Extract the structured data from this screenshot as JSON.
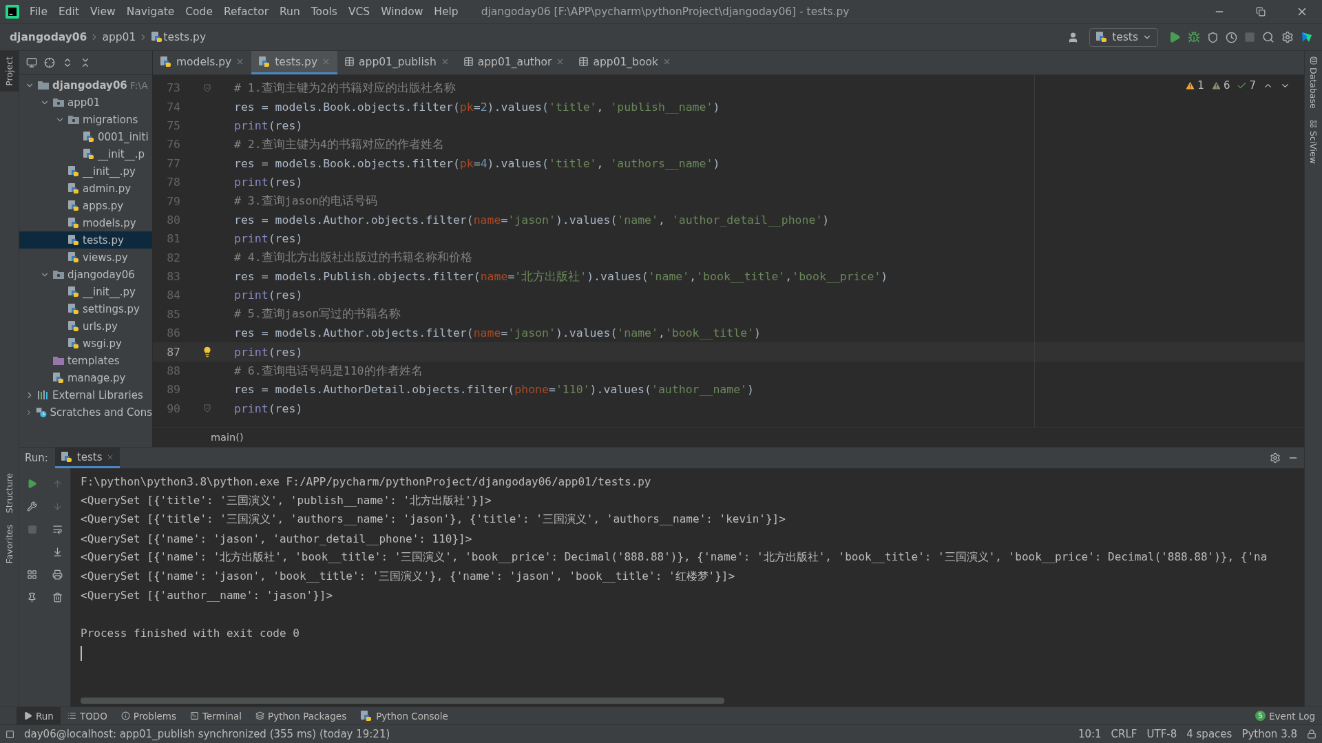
{
  "menu_bar": {
    "items": [
      "File",
      "Edit",
      "View",
      "Navigate",
      "Code",
      "Refactor",
      "Run",
      "Tools",
      "VCS",
      "Window",
      "Help"
    ],
    "title": "djangoday06 [F:\\APP\\pycharm\\pythonProject\\djangoday06] - tests.py"
  },
  "breadcrumbs": [
    {
      "label": "djangoday06",
      "kind": "project"
    },
    {
      "label": "app01",
      "kind": "folder"
    },
    {
      "label": "tests.py",
      "kind": "python"
    }
  ],
  "run_config": {
    "label": "tests"
  },
  "left_strip": [
    {
      "label": "Project",
      "selected": true
    },
    {
      "label": "Structure",
      "selected": false
    },
    {
      "label": "Favorites",
      "selected": false
    }
  ],
  "right_strip": [
    "Database",
    "SciView"
  ],
  "editor_tabs": [
    {
      "label": "models.py",
      "kind": "python",
      "selected": false
    },
    {
      "label": "tests.py",
      "kind": "python",
      "selected": true
    },
    {
      "label": "app01_publish",
      "kind": "table",
      "selected": false
    },
    {
      "label": "app01_author",
      "kind": "table",
      "selected": false
    },
    {
      "label": "app01_book",
      "kind": "table",
      "selected": false
    }
  ],
  "project_tree": [
    {
      "label": "djangoday06",
      "hint": "F:\\A",
      "kind": "project",
      "expanded": true,
      "selected": false,
      "children": [
        {
          "label": "app01",
          "kind": "module",
          "expanded": true,
          "selected": false,
          "children": [
            {
              "label": "migrations",
              "kind": "module",
              "expanded": true,
              "selected": false,
              "children": [
                {
                  "label": "0001_initi",
                  "kind": "python",
                  "selected": false
                },
                {
                  "label": "__init__.p",
                  "kind": "python",
                  "selected": false
                }
              ]
            },
            {
              "label": "__init__.py",
              "kind": "python",
              "selected": false
            },
            {
              "label": "admin.py",
              "kind": "python",
              "selected": false
            },
            {
              "label": "apps.py",
              "kind": "python",
              "selected": false
            },
            {
              "label": "models.py",
              "kind": "python",
              "selected": false
            },
            {
              "label": "tests.py",
              "kind": "python",
              "selected": true
            },
            {
              "label": "views.py",
              "kind": "python",
              "selected": false
            }
          ]
        },
        {
          "label": "djangoday06",
          "kind": "module",
          "expanded": true,
          "selected": false,
          "children": [
            {
              "label": "__init__.py",
              "kind": "python",
              "selected": false
            },
            {
              "label": "settings.py",
              "kind": "python",
              "selected": false
            },
            {
              "label": "urls.py",
              "kind": "python",
              "selected": false
            },
            {
              "label": "wsgi.py",
              "kind": "python",
              "selected": false
            }
          ]
        },
        {
          "label": "templates",
          "kind": "templates",
          "selected": false
        },
        {
          "label": "manage.py",
          "kind": "python",
          "selected": false
        }
      ]
    },
    {
      "label": "External Libraries",
      "kind": "libraries",
      "expanded": false,
      "selected": false
    },
    {
      "label": "Scratches and Cons",
      "kind": "scratches",
      "expanded": false,
      "selected": false
    }
  ],
  "inspections": [
    {
      "kind": "warning",
      "count": "1"
    },
    {
      "kind": "weak_warning",
      "count": "6"
    },
    {
      "kind": "typo",
      "count": "7"
    }
  ],
  "code_lines": [
    {
      "number": "73",
      "current": false,
      "fold_marker": true,
      "tokens": [
        {
          "kind": "comment",
          "text": "# 1.查询主键为2的书籍对应的出版社名称"
        }
      ]
    },
    {
      "number": "74",
      "current": false,
      "fold_marker": false,
      "tokens": [
        {
          "kind": "plain",
          "text": "res = models.Book.objects.filter("
        },
        {
          "kind": "param",
          "text": "pk"
        },
        {
          "kind": "plain",
          "text": "="
        },
        {
          "kind": "number",
          "text": "2"
        },
        {
          "kind": "plain",
          "text": ").values("
        },
        {
          "kind": "string",
          "text": "'title'"
        },
        {
          "kind": "plain",
          "text": ", "
        },
        {
          "kind": "string",
          "text": "'publish__name'"
        },
        {
          "kind": "plain",
          "text": ")"
        }
      ]
    },
    {
      "number": "75",
      "current": false,
      "fold_marker": false,
      "tokens": [
        {
          "kind": "builtin",
          "text": "print"
        },
        {
          "kind": "plain",
          "text": "(res)"
        }
      ]
    },
    {
      "number": "76",
      "current": false,
      "fold_marker": false,
      "tokens": [
        {
          "kind": "comment",
          "text": "# 2.查询主键为4的书籍对应的作者姓名"
        }
      ]
    },
    {
      "number": "77",
      "current": false,
      "fold_marker": false,
      "tokens": [
        {
          "kind": "plain",
          "text": "res = models.Book.objects.filter("
        },
        {
          "kind": "param",
          "text": "pk"
        },
        {
          "kind": "plain",
          "text": "="
        },
        {
          "kind": "number",
          "text": "4"
        },
        {
          "kind": "plain",
          "text": ").values("
        },
        {
          "kind": "string",
          "text": "'title'"
        },
        {
          "kind": "plain",
          "text": ", "
        },
        {
          "kind": "string",
          "text": "'authors__name'"
        },
        {
          "kind": "plain",
          "text": ")"
        }
      ]
    },
    {
      "number": "78",
      "current": false,
      "fold_marker": false,
      "tokens": [
        {
          "kind": "builtin",
          "text": "print"
        },
        {
          "kind": "plain",
          "text": "(res)"
        }
      ]
    },
    {
      "number": "79",
      "current": false,
      "fold_marker": false,
      "tokens": [
        {
          "kind": "comment",
          "text": "# 3.查询jason的电话号码"
        }
      ]
    },
    {
      "number": "80",
      "current": false,
      "fold_marker": false,
      "tokens": [
        {
          "kind": "plain",
          "text": "res = models.Author.objects.filter("
        },
        {
          "kind": "param",
          "text": "name"
        },
        {
          "kind": "plain",
          "text": "="
        },
        {
          "kind": "string",
          "text": "'jason'"
        },
        {
          "kind": "plain",
          "text": ").values("
        },
        {
          "kind": "string",
          "text": "'name'"
        },
        {
          "kind": "plain",
          "text": ", "
        },
        {
          "kind": "string",
          "text": "'author_detail__phone'"
        },
        {
          "kind": "plain",
          "text": ")"
        }
      ]
    },
    {
      "number": "81",
      "current": false,
      "fold_marker": false,
      "tokens": [
        {
          "kind": "builtin",
          "text": "print"
        },
        {
          "kind": "plain",
          "text": "(res)"
        }
      ]
    },
    {
      "number": "82",
      "current": false,
      "fold_marker": false,
      "tokens": [
        {
          "kind": "comment",
          "text": "# 4.查询北方出版社出版过的书籍名称和价格"
        }
      ]
    },
    {
      "number": "83",
      "current": false,
      "fold_marker": false,
      "tokens": [
        {
          "kind": "plain",
          "text": "res = models.Publish.objects.filter("
        },
        {
          "kind": "param",
          "text": "name"
        },
        {
          "kind": "plain",
          "text": "="
        },
        {
          "kind": "string",
          "text": "'北方出版社'"
        },
        {
          "kind": "plain",
          "text": ").values("
        },
        {
          "kind": "string",
          "text": "'name'"
        },
        {
          "kind": "plain",
          "text": ","
        },
        {
          "kind": "string",
          "text": "'book__title'"
        },
        {
          "kind": "plain",
          "text": ","
        },
        {
          "kind": "string",
          "text": "'book__price'"
        },
        {
          "kind": "plain",
          "text": ")"
        }
      ]
    },
    {
      "number": "84",
      "current": false,
      "fold_marker": false,
      "tokens": [
        {
          "kind": "builtin",
          "text": "print"
        },
        {
          "kind": "plain",
          "text": "(res)"
        }
      ]
    },
    {
      "number": "85",
      "current": false,
      "fold_marker": false,
      "tokens": [
        {
          "kind": "comment",
          "text": "# 5.查询jason写过的书籍名称"
        }
      ]
    },
    {
      "number": "86",
      "current": false,
      "fold_marker": false,
      "tokens": [
        {
          "kind": "plain",
          "text": "res = models.Author.objects.filter("
        },
        {
          "kind": "param",
          "text": "name"
        },
        {
          "kind": "plain",
          "text": "="
        },
        {
          "kind": "string",
          "text": "'jason'"
        },
        {
          "kind": "plain",
          "text": ").values("
        },
        {
          "kind": "string",
          "text": "'name'"
        },
        {
          "kind": "plain",
          "text": ","
        },
        {
          "kind": "string",
          "text": "'book__title'"
        },
        {
          "kind": "plain",
          "text": ")"
        }
      ]
    },
    {
      "number": "87",
      "current": true,
      "fold_marker": false,
      "tokens": [
        {
          "kind": "builtin",
          "text": "print"
        },
        {
          "kind": "plain",
          "text": "(res)"
        }
      ]
    },
    {
      "number": "88",
      "current": false,
      "fold_marker": false,
      "tokens": [
        {
          "kind": "comment",
          "text": "# 6.查询电话号码是110的作者姓名"
        }
      ]
    },
    {
      "number": "89",
      "current": false,
      "fold_marker": false,
      "tokens": [
        {
          "kind": "plain",
          "text": "res = models.AuthorDetail.objects.filter("
        },
        {
          "kind": "param",
          "text": "phone"
        },
        {
          "kind": "plain",
          "text": "="
        },
        {
          "kind": "string",
          "text": "'110'"
        },
        {
          "kind": "plain",
          "text": ").values("
        },
        {
          "kind": "string",
          "text": "'author__name'"
        },
        {
          "kind": "plain",
          "text": ")"
        }
      ]
    },
    {
      "number": "90",
      "current": false,
      "fold_marker": true,
      "tokens": [
        {
          "kind": "builtin",
          "text": "print"
        },
        {
          "kind": "plain",
          "text": "(res)"
        }
      ]
    }
  ],
  "editor_breadcrumb": "main()",
  "run_panel": {
    "title": "Run:",
    "tab": "tests",
    "output": [
      "F:\\python\\python3.8\\python.exe F:/APP/pycharm/pythonProject/djangoday06/app01/tests.py",
      "<QuerySet [{'title': '三国演义', 'publish__name': '北方出版社'}]>",
      "<QuerySet [{'title': '三国演义', 'authors__name': 'jason'}, {'title': '三国演义', 'authors__name': 'kevin'}]>",
      "<QuerySet [{'name': 'jason', 'author_detail__phone': 110}]>",
      "<QuerySet [{'name': '北方出版社', 'book__title': '三国演义', 'book__price': Decimal('888.88')}, {'name': '北方出版社', 'book__title': '三国演义', 'book__price': Decimal('888.88')}, {'na",
      "<QuerySet [{'name': 'jason', 'book__title': '三国演义'}, {'name': 'jason', 'book__title': '红楼梦'}]>",
      "<QuerySet [{'author__name': 'jason'}]>"
    ],
    "exit_message": "Process finished with exit code 0"
  },
  "tool_windows": [
    {
      "label": "Run",
      "kind": "run",
      "selected": true
    },
    {
      "label": "TODO",
      "kind": "todo",
      "selected": false
    },
    {
      "label": "Problems",
      "kind": "problems",
      "selected": false
    },
    {
      "label": "Terminal",
      "kind": "terminal",
      "selected": false
    },
    {
      "label": "Python Packages",
      "kind": "packages",
      "selected": false
    },
    {
      "label": "Python Console",
      "kind": "console",
      "selected": false
    }
  ],
  "event_log": {
    "count": "5",
    "label": "Event Log"
  },
  "status_bar": {
    "message": "day06@localhost: app01_publish synchronized (355 ms) (today 19:21)",
    "items": [
      "10:1",
      "CRLF",
      "UTF-8",
      "4 spaces",
      "Python 3.8"
    ]
  }
}
